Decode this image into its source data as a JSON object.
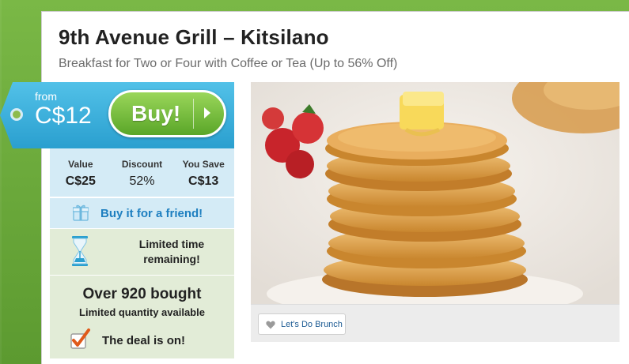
{
  "deal": {
    "title": "9th Avenue Grill – Kitsilano",
    "subtitle": "Breakfast for Two or Four with Coffee or Tea (Up to 56% Off)"
  },
  "pricing": {
    "from_label": "from",
    "price": "C$12",
    "buy_label": "Buy!"
  },
  "stats": [
    {
      "label": "Value",
      "value": "C$25"
    },
    {
      "label": "Discount",
      "value": "52%"
    },
    {
      "label": "You Save",
      "value": "C$13"
    }
  ],
  "gift": {
    "label": "Buy it for a friend!",
    "icon": "gift-icon"
  },
  "timer": {
    "label": "Limited time remaining!",
    "icon": "hourglass-icon"
  },
  "status": {
    "bought": "Over 920 bought",
    "limited": "Limited quantity available",
    "deal_on": "The deal is on!",
    "icon": "check-icon"
  },
  "photo": {
    "tag_label": "Let's Do Brunch",
    "tag_icon": "heart-icon"
  },
  "colors": {
    "accent_blue": "#2a9fcf",
    "buy_green": "#5aa628",
    "link_blue": "#1e7fc0",
    "background_green": "#6fae3e"
  }
}
